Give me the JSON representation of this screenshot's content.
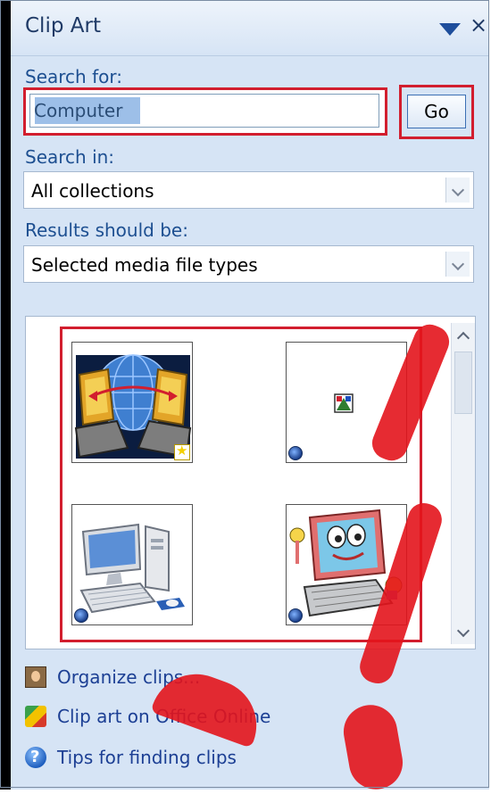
{
  "panel": {
    "title": "Clip Art",
    "menu_icon": "dropdown-triangle-icon",
    "close_glyph": "×"
  },
  "search": {
    "label": "Search for:",
    "value": "Computer",
    "go_label": "Go"
  },
  "search_in": {
    "label": "Search in:",
    "selected": "All collections"
  },
  "results_type": {
    "label": "Results should be:",
    "selected": "Selected media file types"
  },
  "results": {
    "clips": [
      {
        "name": "computers-network-globe-clip",
        "badge": "new-star"
      },
      {
        "name": "small-picture-clip",
        "badge": "web-globe"
      },
      {
        "name": "desktop-pc-clip",
        "badge": "web-globe"
      },
      {
        "name": "cartoon-computer-clip",
        "badge": "web-globe"
      }
    ]
  },
  "links": [
    {
      "label": "Organize clips...",
      "icon": "organize-clips-icon"
    },
    {
      "label": "Clip art on Office Online",
      "icon": "office-online-icon"
    },
    {
      "label": "Tips for finding clips",
      "icon": "help-icon"
    }
  ],
  "colors": {
    "panel_bg": "#d6e4f5",
    "label_blue": "#1d4f91",
    "link_blue": "#1c3f94",
    "highlight_red": "#d21e2e"
  }
}
